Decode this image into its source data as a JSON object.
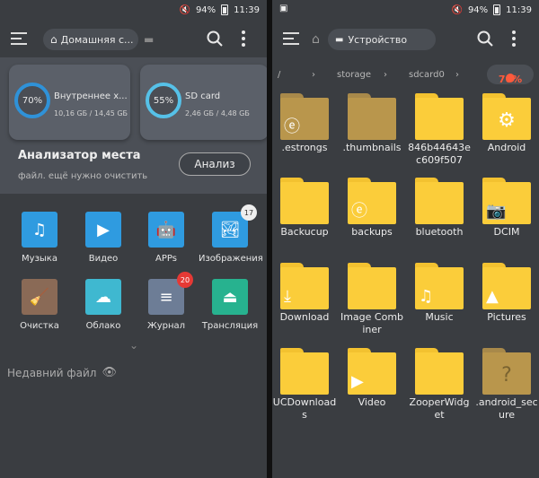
{
  "status": {
    "battery": "94%",
    "time": "11:39"
  },
  "left": {
    "title": "Домашняя с...",
    "storage": [
      {
        "percent": "70%",
        "label": "Внутреннее х...",
        "usage": "10,16 GБ / 14,45 GБ"
      },
      {
        "percent": "55%",
        "label": "SD card",
        "usage": "2,46 GБ / 4,48 GБ"
      }
    ],
    "analyzer": {
      "title": "Анализатор места",
      "subtitle": "файл. ещё нужно очистить",
      "button": "Анализ"
    },
    "categories": [
      {
        "label": "Музыка",
        "icon": "music-note-icon",
        "color": "#2f9be0"
      },
      {
        "label": "Видео",
        "icon": "video-icon",
        "color": "#2f9be0"
      },
      {
        "label": "APPs",
        "icon": "android-icon",
        "color": "#2f9be0"
      },
      {
        "label": "Изображения",
        "icon": "image-icon",
        "color": "#2f9be0",
        "badge": "17"
      },
      {
        "label": "Очистка",
        "icon": "broom-icon",
        "color": "#8a6a56"
      },
      {
        "label": "Облако",
        "icon": "cloud-icon",
        "color": "#3fb8d0"
      },
      {
        "label": "Журнал",
        "icon": "stack-icon",
        "color": "#6d7d96",
        "badge": "20"
      },
      {
        "label": "Трансляция",
        "icon": "cast-icon",
        "color": "#27b28f"
      }
    ],
    "recent": "Недавний файл"
  },
  "right": {
    "title": "Устройство",
    "path": [
      "/",
      "storage",
      "sdcard0"
    ],
    "usage": "70%",
    "folders": [
      {
        "name": ".estrongs",
        "icon": "es-logo-icon",
        "dim": true
      },
      {
        "name": ".thumbnails",
        "icon": "",
        "dim": true
      },
      {
        "name": "846b44643ec609f507",
        "icon": ""
      },
      {
        "name": "Android",
        "icon": "gear-icon"
      },
      {
        "name": "Backucup",
        "icon": ""
      },
      {
        "name": "backups",
        "icon": "es-logo-icon"
      },
      {
        "name": "bluetooth",
        "icon": ""
      },
      {
        "name": "DCIM",
        "icon": "camera-icon"
      },
      {
        "name": "Download",
        "icon": "download-icon"
      },
      {
        "name": "Image Combiner",
        "icon": ""
      },
      {
        "name": "Music",
        "icon": "music-note-icon"
      },
      {
        "name": "Pictures",
        "icon": "image-icon"
      },
      {
        "name": "UCDownloads",
        "icon": ""
      },
      {
        "name": "Video",
        "icon": "play-icon"
      },
      {
        "name": "ZooperWidget",
        "icon": ""
      },
      {
        "name": ".android_secure",
        "icon": "question-icon",
        "dim": true
      }
    ]
  },
  "colors": {
    "accent": "#2f92d8",
    "folder": "#fbcd3a",
    "warning": "#ff5a3c",
    "badge_red": "#e53935"
  }
}
